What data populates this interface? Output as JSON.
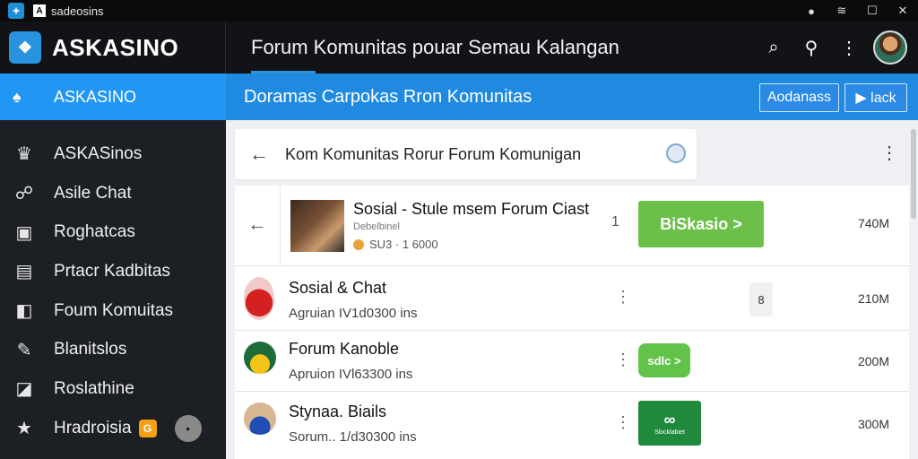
{
  "window": {
    "title": "sadeosins",
    "controls": [
      "●",
      "≋",
      "☐",
      "✕"
    ]
  },
  "header": {
    "brand": "ASKASINO",
    "title": "Forum Komunitas pouar Semau Kalangan",
    "icons": {
      "search": "⌕",
      "find": "⚲",
      "more": "⋮"
    }
  },
  "sidebar": {
    "active": {
      "label": "ASKASINO",
      "icon": "♠"
    },
    "items": [
      {
        "label": "ASKASinos",
        "icon": "♛"
      },
      {
        "label": "Asile Chat",
        "icon": "☍"
      },
      {
        "label": "Roghatcas",
        "icon": "▣"
      },
      {
        "label": "Prtacr Kadbitas",
        "icon": "▤"
      },
      {
        "label": "Foum Komuitas",
        "icon": "◧"
      },
      {
        "label": "Blanitslos",
        "icon": "✎"
      },
      {
        "label": "Roslathine",
        "icon": "◪"
      },
      {
        "label": "Hradroisia",
        "icon": "★",
        "badge": "G",
        "toggle": "•"
      }
    ]
  },
  "subheader": {
    "breadcrumb": "Doramas Carpokas Rron Komunitas",
    "btn1": "Aodanass",
    "btn2": "▶ lack"
  },
  "content": {
    "search_query": "Kom Komunitas Rorur Forum Komunigan",
    "back_glyph": "←",
    "more_glyph": "⋮",
    "rows": [
      {
        "back_glyph": "←",
        "title": "Sosial - Stule msem Forum  Ciast",
        "sub": "Debelbinel",
        "meta": "SU3 · 1 6000",
        "num": "1",
        "cta": "BiSkasio >",
        "size": "740M"
      },
      {
        "title": "Sosial & Chat",
        "sub": "Agruian IV1d0300 ins",
        "menu": "⋮",
        "chip": "8",
        "size": "210M"
      },
      {
        "title": "Forum Kanoble",
        "sub": "Apruion IVl63300 ins",
        "menu": "⋮",
        "chip": "sdlc >",
        "size": "200M"
      },
      {
        "title": "Stynaa. Biails",
        "sub": "Sorum.. 1/d30300 ins",
        "menu": "⋮",
        "chip_big": "∞",
        "chip_small": "Slocklabiet",
        "size": "300M"
      }
    ]
  },
  "colors": {
    "accent": "#2196f3",
    "header_bg": "#111317",
    "sidebar_bg": "#1c1f24",
    "green": "#6cc04a"
  }
}
